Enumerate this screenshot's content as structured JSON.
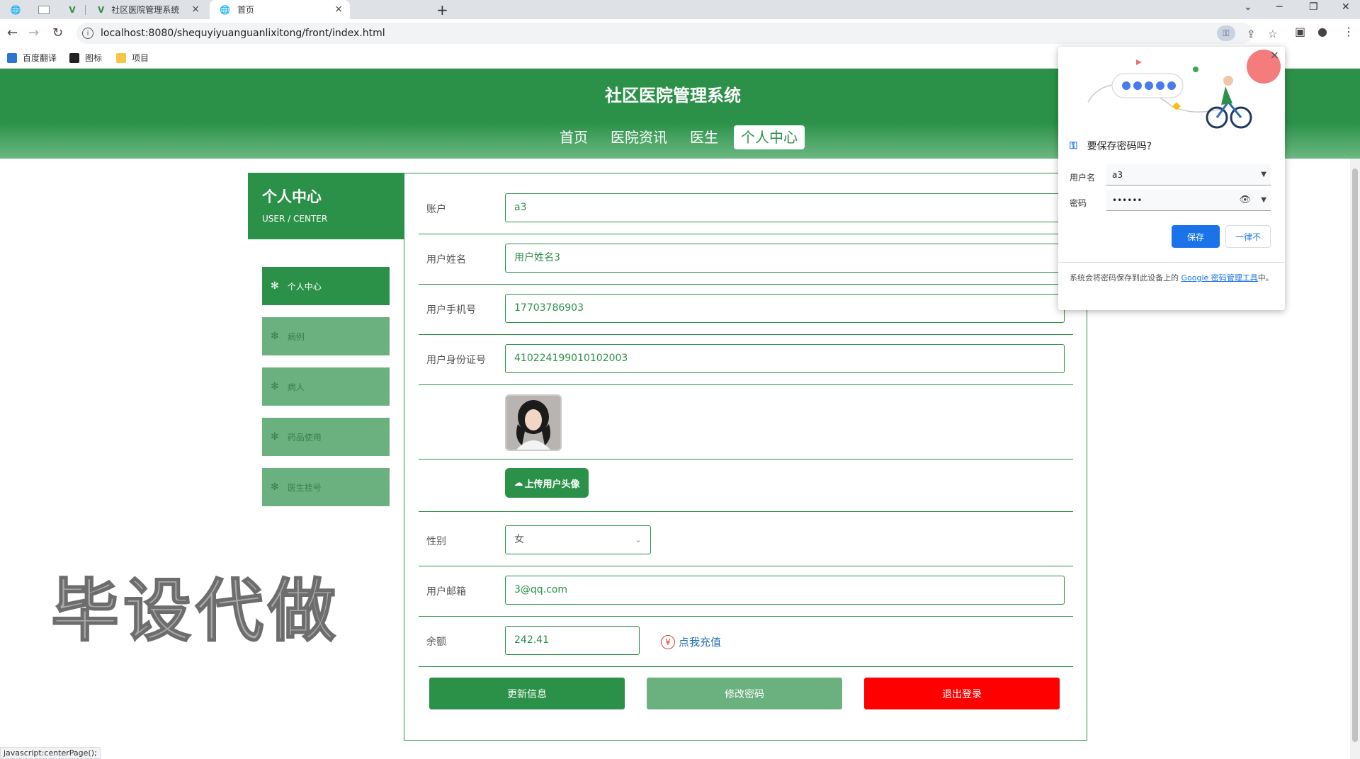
{
  "browser": {
    "tabs": [
      {
        "title": "社区医院管理系统",
        "close": "×"
      },
      {
        "title": "首页",
        "close": "×"
      }
    ],
    "new_tab": "+",
    "url": "localhost:8080/shequyiyuanguanlixitong/front/index.html",
    "bookmarks": [
      "百度翻译",
      "图标",
      "项目"
    ]
  },
  "site": {
    "title": "社区医院管理系统",
    "nav": [
      {
        "label": "首页",
        "active": false
      },
      {
        "label": "医院资讯",
        "active": false
      },
      {
        "label": "医生",
        "active": false
      },
      {
        "label": "个人中心",
        "active": true
      }
    ]
  },
  "sidebar": {
    "title": "个人中心",
    "subtitle": "USER / CENTER",
    "items": [
      {
        "label": "个人中心",
        "active": true
      },
      {
        "label": "病例",
        "active": false
      },
      {
        "label": "病人",
        "active": false
      },
      {
        "label": "药品使用",
        "active": false
      },
      {
        "label": "医生挂号",
        "active": false
      }
    ]
  },
  "form": {
    "account": {
      "label": "账户",
      "value": "a3"
    },
    "name": {
      "label": "用户姓名",
      "value": "用户姓名3"
    },
    "phone": {
      "label": "用户手机号",
      "value": "17703786903"
    },
    "id_card": {
      "label": "用户身份证号",
      "value": "410224199010102003"
    },
    "upload_label": "上传用户头像",
    "gender": {
      "label": "性别",
      "value": "女"
    },
    "email": {
      "label": "用户邮箱",
      "value": "3@qq.com"
    },
    "balance": {
      "label": "余额",
      "value": "242.41",
      "recharge": "点我充值"
    },
    "buttons": {
      "update": "更新信息",
      "change_password": "修改密码",
      "logout": "退出登录"
    }
  },
  "watermark": "毕设代做",
  "status_bar": "javascript:centerPage();",
  "password_popup": {
    "question": "要保存密码吗?",
    "username_label": "用户名",
    "username_value": "a3",
    "password_label": "密码",
    "password_value": "••••••",
    "save": "保存",
    "never": "一律不",
    "footer_text": "系统会将密码保存到此设备上的",
    "footer_link": "Google 密码管理工具",
    "footer_end": "中。"
  },
  "colors": {
    "primary": "#2b9148",
    "secondary": "#6ab17f",
    "danger": "#ff0000",
    "link": "#1a73e8"
  }
}
